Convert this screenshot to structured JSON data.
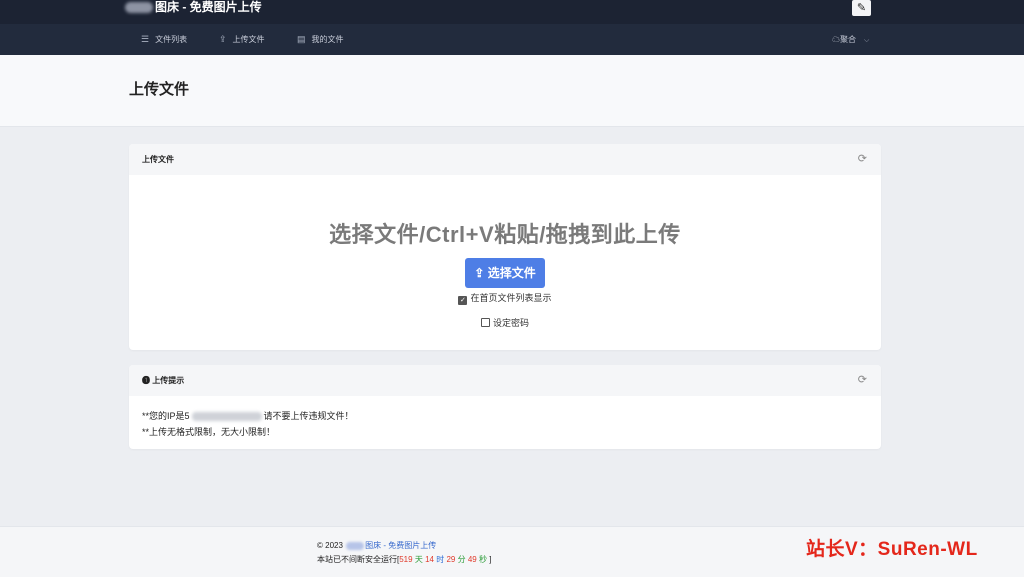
{
  "header": {
    "brand_suffix": "图床 - 免费图片上传",
    "brush_glyph": "✎"
  },
  "nav": {
    "items": [
      {
        "label": "文件列表",
        "icon": "list-icon",
        "glyph": "☰"
      },
      {
        "label": "上传文件",
        "icon": "upload-icon",
        "glyph": "⇪"
      },
      {
        "label": "我的文件",
        "icon": "file-icon",
        "glyph": "▤"
      }
    ],
    "user": {
      "label": "聚合",
      "glyph": "☁",
      "chevron": "⌵"
    }
  },
  "page": {
    "title": "上传文件"
  },
  "upload_card": {
    "title": "上传文件",
    "refresh_glyph": "⟳",
    "drop_text": "选择文件/Ctrl+V粘贴/拖拽到此上传",
    "button_icon": "⇪",
    "button_label": "选择文件",
    "show_on_home": {
      "label": "在首页文件列表显示",
      "checked": true,
      "mark": "✓"
    },
    "set_password": {
      "label": "设定密码",
      "checked": false
    }
  },
  "tips_card": {
    "icon": "❶",
    "title": "上传提示",
    "refresh_glyph": "⟳",
    "line1_prefix": "**您的IP是",
    "line1_ip_visible": "5",
    "line1_suffix": "请不要上传违规文件！",
    "line2": "**上传无格式限制，无大小限制！"
  },
  "footer": {
    "copyright": "© 2023",
    "site_name": "图床 - 免费图片上传",
    "uptime_prefix": "本站已不间断安全运行[",
    "days": "519",
    "days_unit": "天",
    "hours": "14",
    "hours_unit": "时",
    "minutes": "29",
    "minutes_unit": "分",
    "seconds": "49",
    "seconds_unit": "秒",
    "uptime_suffix": "]"
  },
  "watermark": "站长V：SuRen-WL"
}
